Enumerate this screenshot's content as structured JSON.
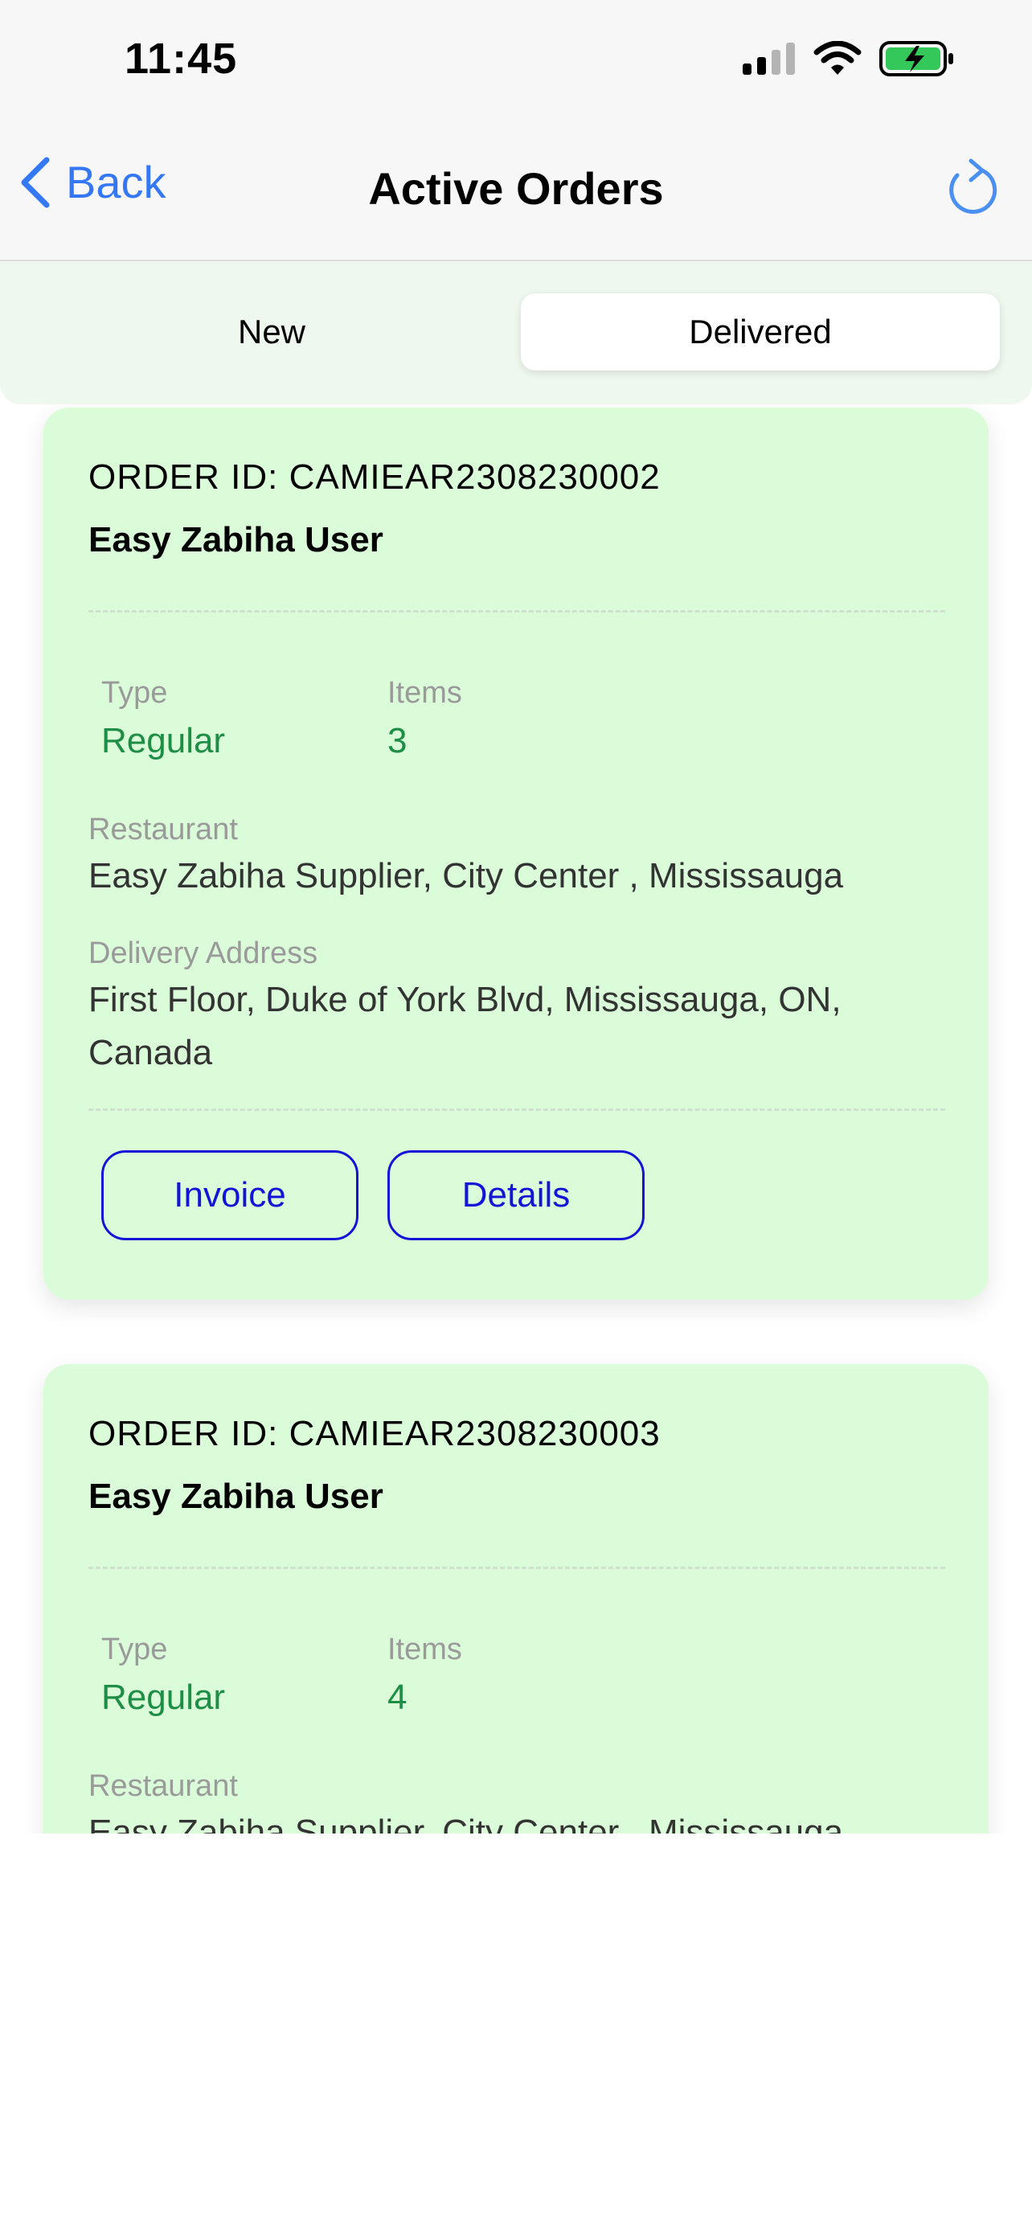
{
  "status_bar": {
    "time": "11:45",
    "icons": [
      "cellular-signal-icon",
      "wifi-icon",
      "battery-charging-icon"
    ],
    "battery_color": "#34c759"
  },
  "nav": {
    "back_label": "Back",
    "title": "Active Orders",
    "accent_color": "#3478f6",
    "icons": [
      "chevron-left-icon",
      "refresh-icon"
    ]
  },
  "segments": {
    "items": [
      "New",
      "Delivered"
    ],
    "selected": "Delivered"
  },
  "labels": {
    "type": "Type",
    "items": "Items",
    "restaurant": "Restaurant",
    "delivery_address": "Delivery Address"
  },
  "orders": [
    {
      "order_id": "ORDER ID: CAMIEAR2308230002",
      "customer": "Easy Zabiha User",
      "type": "Regular",
      "items": "3",
      "restaurant": "Easy Zabiha Supplier, City Center , Mississauga",
      "delivery_address": "First Floor, Duke of York Blvd, Mississauga, ON, Canada",
      "buttons": {
        "invoice": "Invoice",
        "details": "Details"
      }
    },
    {
      "order_id": "ORDER ID: CAMIEAR2308230003",
      "customer": "Easy Zabiha User",
      "type": "Regular",
      "items": "4",
      "restaurant": "Easy Zabiha Supplier, City Center , Mississauga"
    }
  ],
  "colors": {
    "card_background": "#dafcd8",
    "value_green": "#1e8e46",
    "button_blue": "#1414d8"
  }
}
